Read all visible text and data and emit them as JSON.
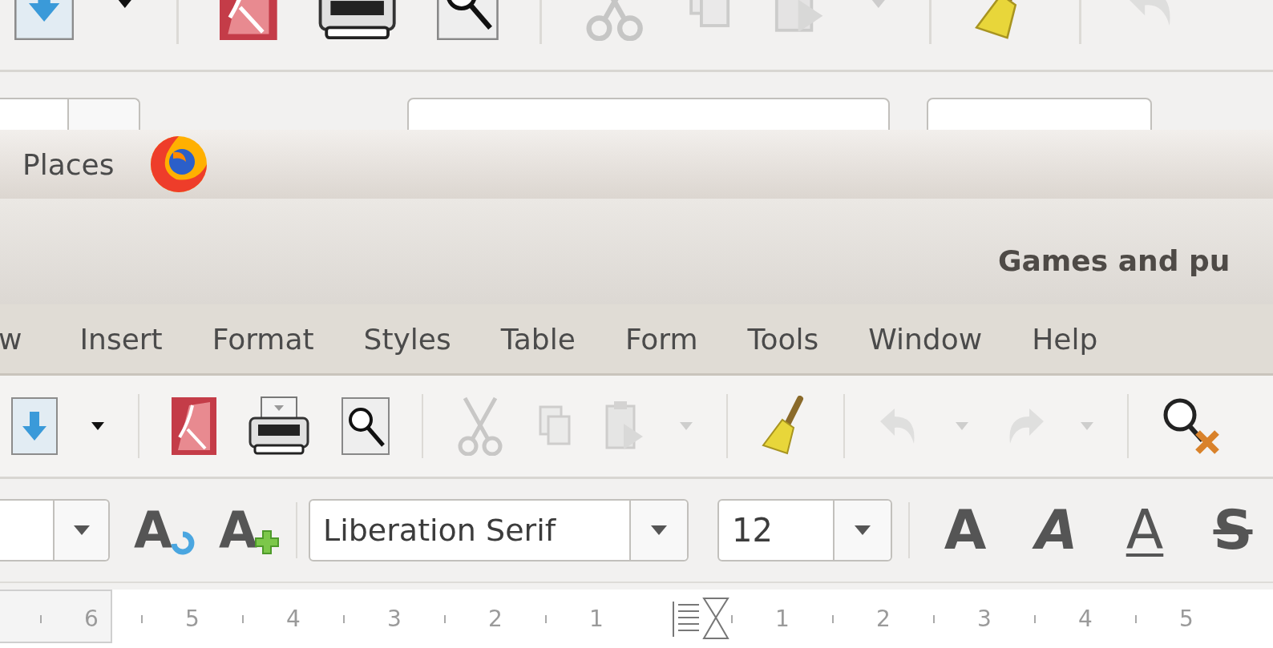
{
  "background_window": {
    "toolbar": [
      {
        "kind": "save",
        "disabled": false
      },
      {
        "kind": "caret",
        "disabled": false
      },
      {
        "kind": "separator"
      },
      {
        "kind": "pdf",
        "disabled": false
      },
      {
        "kind": "print",
        "disabled": false
      },
      {
        "kind": "preview",
        "disabled": false
      },
      {
        "kind": "separator"
      },
      {
        "kind": "cut",
        "disabled": true
      },
      {
        "kind": "copy",
        "disabled": true
      },
      {
        "kind": "paste",
        "disabled": true
      },
      {
        "kind": "caret",
        "disabled": true
      },
      {
        "kind": "separator"
      },
      {
        "kind": "clone",
        "disabled": false
      },
      {
        "kind": "separator"
      },
      {
        "kind": "undo",
        "disabled": true
      }
    ]
  },
  "top_bar": {
    "label": "Places"
  },
  "window": {
    "title": "Games and pu"
  },
  "menu": [
    "w",
    "Insert",
    "Format",
    "Styles",
    "Table",
    "Form",
    "Tools",
    "Window",
    "Help"
  ],
  "toolbar": [
    {
      "kind": "save",
      "disabled": false
    },
    {
      "kind": "caret",
      "disabled": false
    },
    {
      "kind": "separator"
    },
    {
      "kind": "pdf",
      "disabled": false
    },
    {
      "kind": "print",
      "disabled": false
    },
    {
      "kind": "preview",
      "disabled": false
    },
    {
      "kind": "separator"
    },
    {
      "kind": "cut",
      "disabled": true
    },
    {
      "kind": "copy",
      "disabled": true
    },
    {
      "kind": "paste",
      "disabled": true
    },
    {
      "kind": "caret",
      "disabled": true
    },
    {
      "kind": "separator"
    },
    {
      "kind": "clone",
      "disabled": false
    },
    {
      "kind": "separator"
    },
    {
      "kind": "undo",
      "disabled": true
    },
    {
      "kind": "caret",
      "disabled": true
    },
    {
      "kind": "redo",
      "disabled": true
    },
    {
      "kind": "caret",
      "disabled": true
    },
    {
      "kind": "separator"
    },
    {
      "kind": "find",
      "disabled": false
    }
  ],
  "formatting": {
    "font_name": "Liberation Serif",
    "font_size": "12",
    "style_buttons": [
      {
        "kind": "update_style",
        "glyph": "A"
      },
      {
        "kind": "new_style",
        "glyph": "A"
      }
    ],
    "text_buttons": [
      {
        "kind": "bold",
        "glyph": "A"
      },
      {
        "kind": "italic",
        "glyph": "A"
      },
      {
        "kind": "underline",
        "glyph": "A"
      },
      {
        "kind": "strikethrough",
        "glyph": "S"
      }
    ]
  },
  "ruler": {
    "left_numbers": [
      "6",
      "5",
      "4",
      "3",
      "2",
      "1"
    ],
    "right_numbers": [
      "1",
      "2",
      "3",
      "4",
      "5"
    ]
  }
}
